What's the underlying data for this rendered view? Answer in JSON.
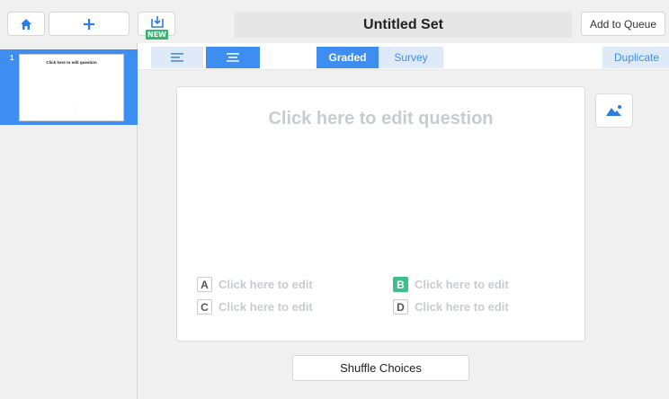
{
  "header": {
    "title": "Untitled Set",
    "home_icon": "home-icon",
    "add_icon": "plus-icon",
    "import_icon": "import-icon",
    "import_badge": "NEW",
    "queue_label": "Add to Queue"
  },
  "sidebar": {
    "slides": [
      {
        "number": "1",
        "text": "Click here to edit question"
      }
    ]
  },
  "toolbar": {
    "align_left_icon": "align-left-icon",
    "align_center_icon": "align-center-icon",
    "graded_label": "Graded",
    "survey_label": "Survey",
    "duplicate_label": "Duplicate"
  },
  "editor": {
    "question_placeholder": "Click here to edit question",
    "choices": [
      {
        "letter": "A",
        "text": "Click here to edit",
        "correct": false
      },
      {
        "letter": "B",
        "text": "Click here to edit",
        "correct": true
      },
      {
        "letter": "C",
        "text": "Click here to edit",
        "correct": false
      },
      {
        "letter": "D",
        "text": "Click here to edit",
        "correct": false
      }
    ],
    "image_icon": "image-icon",
    "shuffle_label": "Shuffle Choices"
  },
  "colors": {
    "accent": "#3d8ef0",
    "correct": "#3cc08a",
    "new_badge": "#3cb371"
  }
}
